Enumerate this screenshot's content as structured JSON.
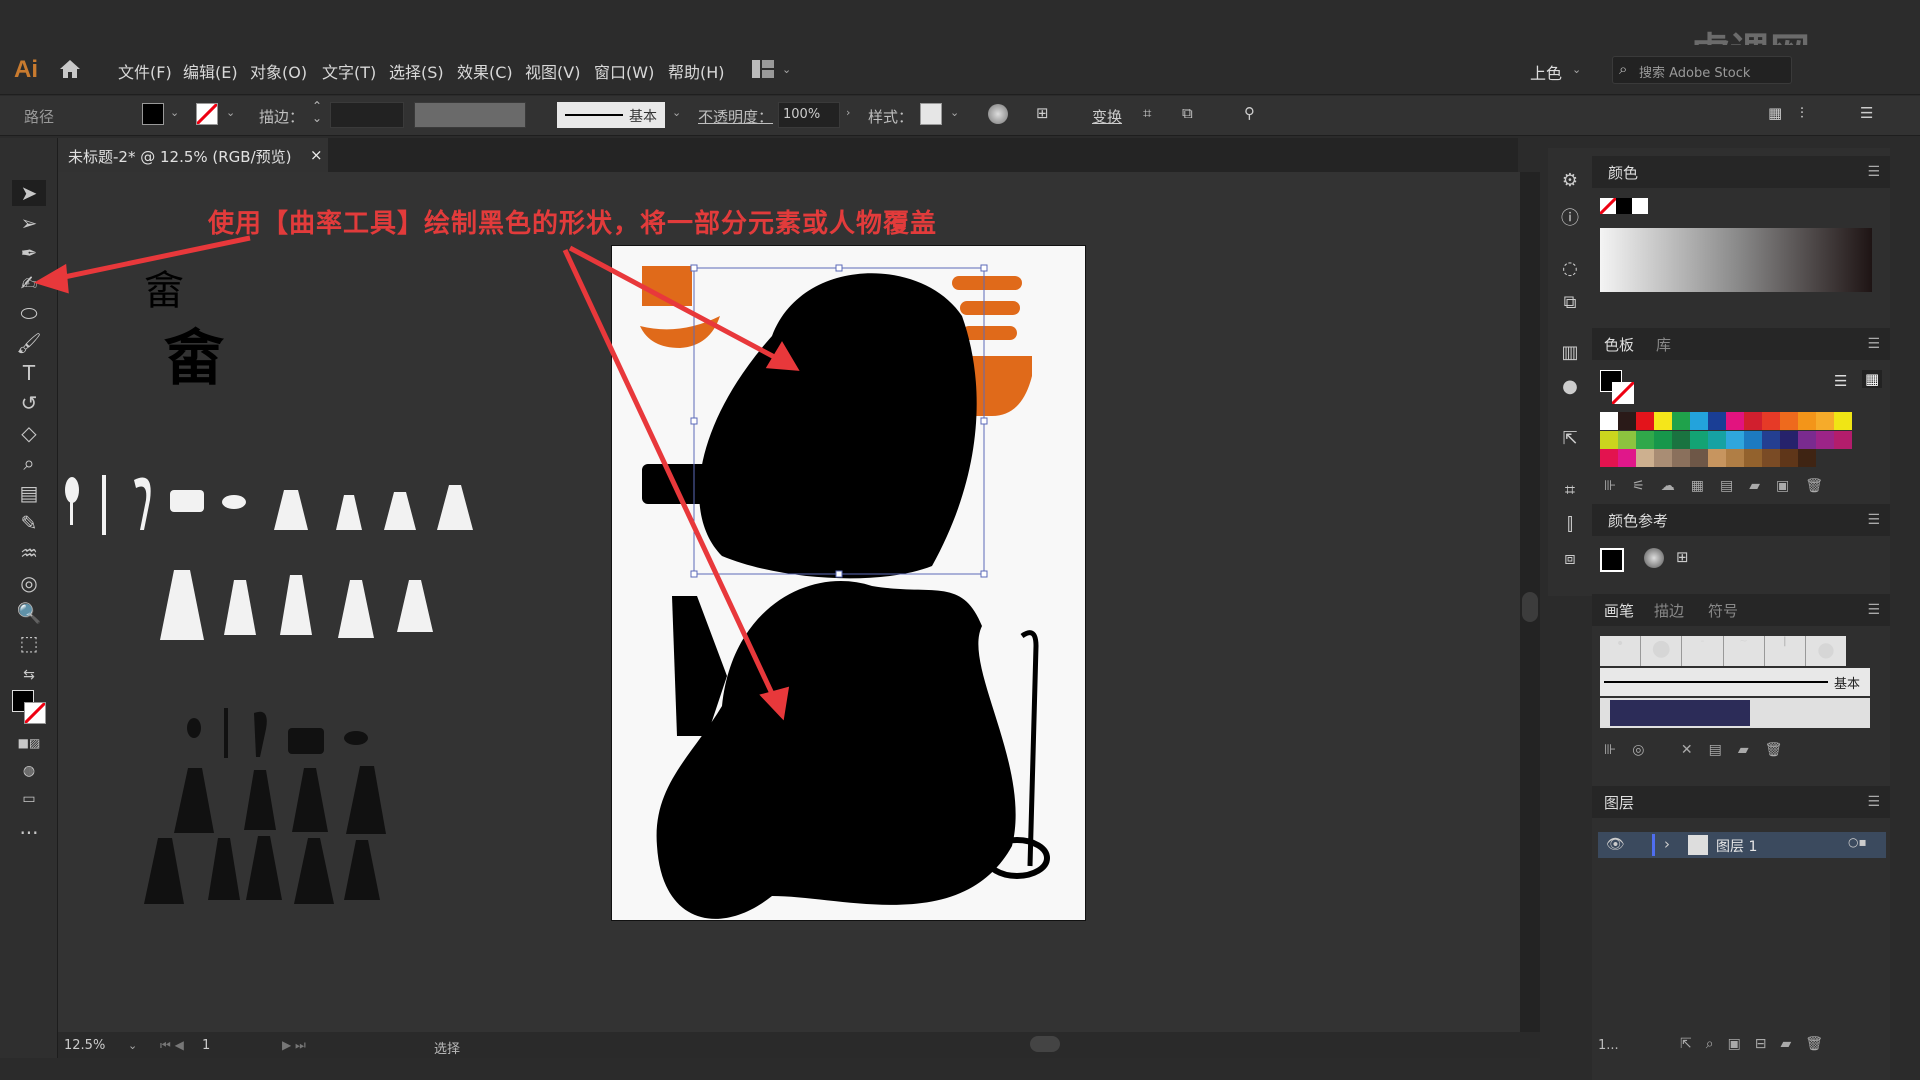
{
  "app": {
    "logo": "Ai",
    "watermark": "虎课网"
  },
  "menu": [
    "文件(F)",
    "编辑(E)",
    "对象(O)",
    "文字(T)",
    "选择(S)",
    "效果(C)",
    "视图(V)",
    "窗口(W)",
    "帮助(H)"
  ],
  "topright": {
    "workspace": "上色",
    "search_placeholder": "搜索 Adobe Stock"
  },
  "control": {
    "selection_type": "路径",
    "stroke_label": "描边：",
    "brush_style": "基本",
    "opacity_label": "不透明度：",
    "opacity_value": "100%",
    "style_label": "样式：",
    "transform_label": "变换"
  },
  "document": {
    "tab_title": "未标题-2* @ 12.5% (RGB/预览)",
    "close": "×"
  },
  "annotation": "使用【曲率工具】绘制黑色的形状，将一部分元素或人物覆盖",
  "status": {
    "zoom": "12.5%",
    "page": "1",
    "mode": "选择"
  },
  "panels": {
    "color": {
      "title": "颜色"
    },
    "swatches": {
      "tabs": [
        "色板",
        "库"
      ]
    },
    "color_guide": {
      "title": "颜色参考"
    },
    "brushes": {
      "tabs": [
        "画笔",
        "描边",
        "符号"
      ],
      "basic_label": "基本"
    },
    "layers": {
      "title": "图层",
      "layer_name": "图层 1",
      "count": "1..."
    }
  },
  "swatch_colors": [
    "#ffffff",
    "#2a1a18",
    "#e3141b",
    "#f5e61a",
    "#1fa24b",
    "#23a3dc",
    "#1a3e95",
    "#e2137f",
    "#d11f2e",
    "#e63a27",
    "#ee6a1d",
    "#f39519",
    "#f6ab2a",
    "#f0e515",
    "#cbd51e",
    "#8cc43f",
    "#30a84a",
    "#17974b",
    "#1a7340",
    "#13a374",
    "#16a2a3",
    "#2fa6dd",
    "#1d7ac0",
    "#243f91",
    "#26226b",
    "#7a2b8f",
    "#9c2488",
    "#b31d6c",
    "#e3134f",
    "#e0178a",
    "#cdb08f",
    "#a98d74",
    "#8a705c",
    "#6e5747",
    "#c7955f",
    "#b07e45",
    "#93622d",
    "#7a4b25",
    "#5f3619",
    "#3f2413"
  ]
}
